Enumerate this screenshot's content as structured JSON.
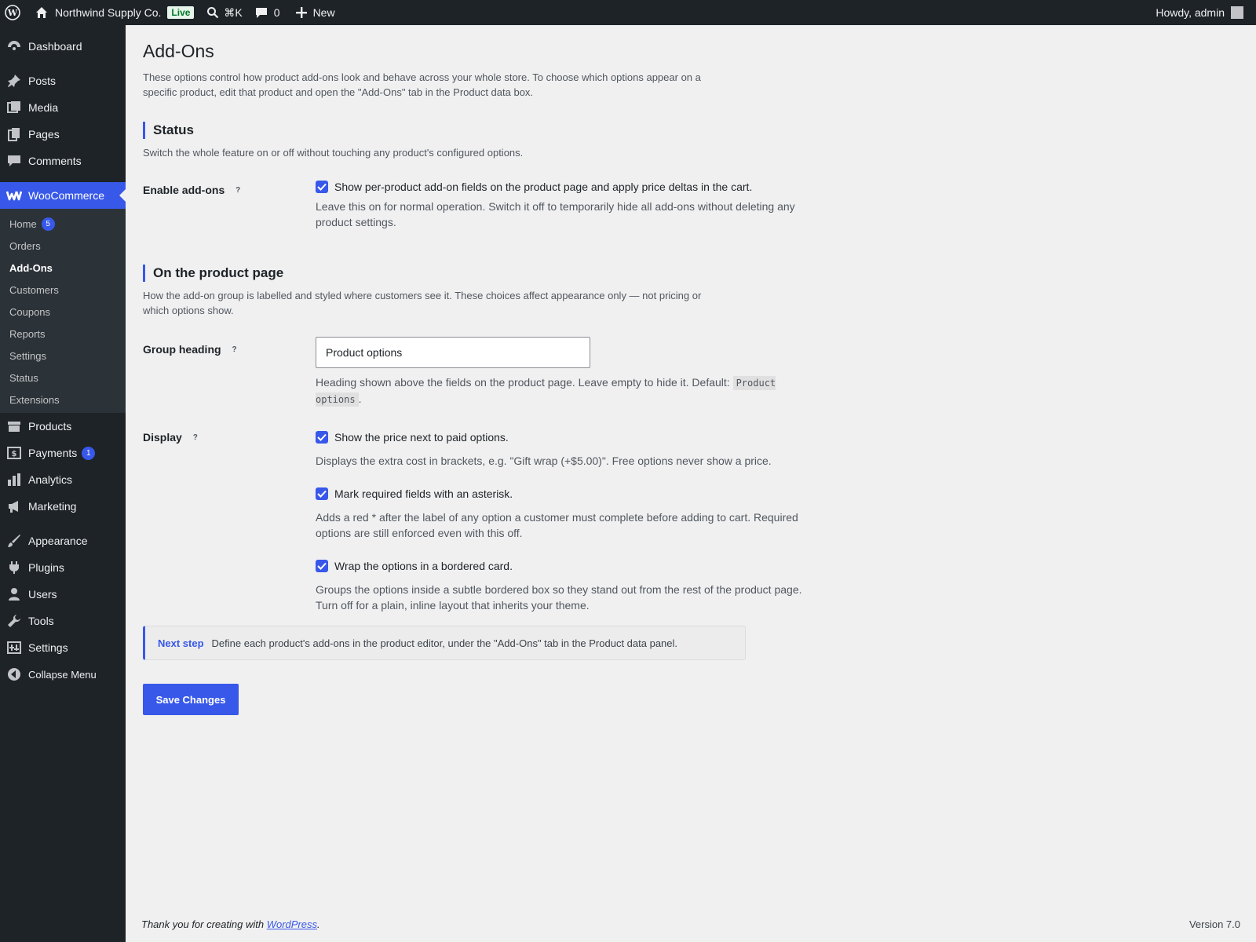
{
  "adminbar": {
    "site_name": "Northwind Supply Co.",
    "live_badge": "Live",
    "search_shortcut": "⌘K",
    "comments_count": "0",
    "new_label": "New",
    "howdy": "Howdy, admin"
  },
  "sidebar": {
    "top_items": [
      {
        "label": "Dashboard",
        "icon": "dashboard-icon"
      }
    ],
    "group2": [
      {
        "label": "Posts",
        "icon": "pin-icon"
      },
      {
        "label": "Media",
        "icon": "media-icon"
      },
      {
        "label": "Pages",
        "icon": "pages-icon"
      },
      {
        "label": "Comments",
        "icon": "comments-icon"
      }
    ],
    "woocommerce": {
      "label": "WooCommerce",
      "icon": "woo-icon"
    },
    "submenu": [
      {
        "label": "Home",
        "badge": "5"
      },
      {
        "label": "Orders"
      },
      {
        "label": "Add-Ons"
      },
      {
        "label": "Customers"
      },
      {
        "label": "Coupons"
      },
      {
        "label": "Reports"
      },
      {
        "label": "Settings"
      },
      {
        "label": "Status"
      },
      {
        "label": "Extensions"
      }
    ],
    "group3": [
      {
        "label": "Products",
        "icon": "products-icon"
      },
      {
        "label": "Payments",
        "icon": "payments-icon",
        "badge": "1"
      },
      {
        "label": "Analytics",
        "icon": "analytics-icon"
      },
      {
        "label": "Marketing",
        "icon": "marketing-icon"
      }
    ],
    "group4": [
      {
        "label": "Appearance",
        "icon": "brush-icon"
      },
      {
        "label": "Plugins",
        "icon": "plugins-icon"
      },
      {
        "label": "Users",
        "icon": "users-icon"
      },
      {
        "label": "Tools",
        "icon": "wrench-icon"
      },
      {
        "label": "Settings",
        "icon": "settings-icon"
      },
      {
        "label": "Collapse Menu",
        "icon": "collapse-icon"
      }
    ]
  },
  "page": {
    "title": "Add-Ons",
    "intro": "These options control how product add-ons look and behave across your whole store. To choose which options appear on a specific product, edit that product and open the \"Add-Ons\" tab in the Product data box."
  },
  "status": {
    "heading": "Status",
    "desc": "Switch the whole feature on or off without touching any product's configured options.",
    "enable_label": "Enable add-ons",
    "enable_check": "Show per-product add-on fields on the product page and apply price deltas in the cart.",
    "enable_checked": true,
    "enable_desc": "Leave this on for normal operation. Switch it off to temporarily hide all add-ons without deleting any product settings."
  },
  "product_page": {
    "heading": "On the product page",
    "desc": "How the add-on group is labelled and styled where customers see it. These choices affect appearance only — not pricing or which options show.",
    "group_heading_label": "Group heading",
    "group_heading_value": "Product options",
    "group_heading_desc": "Heading shown above the fields on the product page. Leave empty to hide it. Default:",
    "group_heading_default": "Product options",
    "group_heading_period": ".",
    "display_label": "Display",
    "display_options": [
      {
        "label": "Show the price next to paid options.",
        "checked": true,
        "desc": "Displays the extra cost in brackets, e.g. \"Gift wrap (+$5.00)\". Free options never show a price."
      },
      {
        "label": "Mark required fields with an asterisk.",
        "checked": true,
        "desc": "Adds a red * after the label of any option a customer must complete before adding to cart. Required options are still enforced even with this off."
      },
      {
        "label": "Wrap the options in a bordered card.",
        "checked": true,
        "desc": "Groups the options inside a subtle bordered box so they stand out from the rest of the product page. Turn off for a plain, inline layout that inherits your theme."
      }
    ]
  },
  "notice": {
    "strong": "Next step",
    "text": "Define each product's add-ons in the product editor, under the \"Add-Ons\" tab in the Product data panel."
  },
  "save_label": "Save Changes",
  "footer": {
    "thanks_prefix": "Thank you for creating with ",
    "link": "WordPress",
    "thanks_suffix": ".",
    "version": "Version 7.0"
  },
  "colors": {
    "accent": "#3858e9",
    "sidebar_bg": "#1d2327",
    "page_bg": "#f0f0f1"
  }
}
